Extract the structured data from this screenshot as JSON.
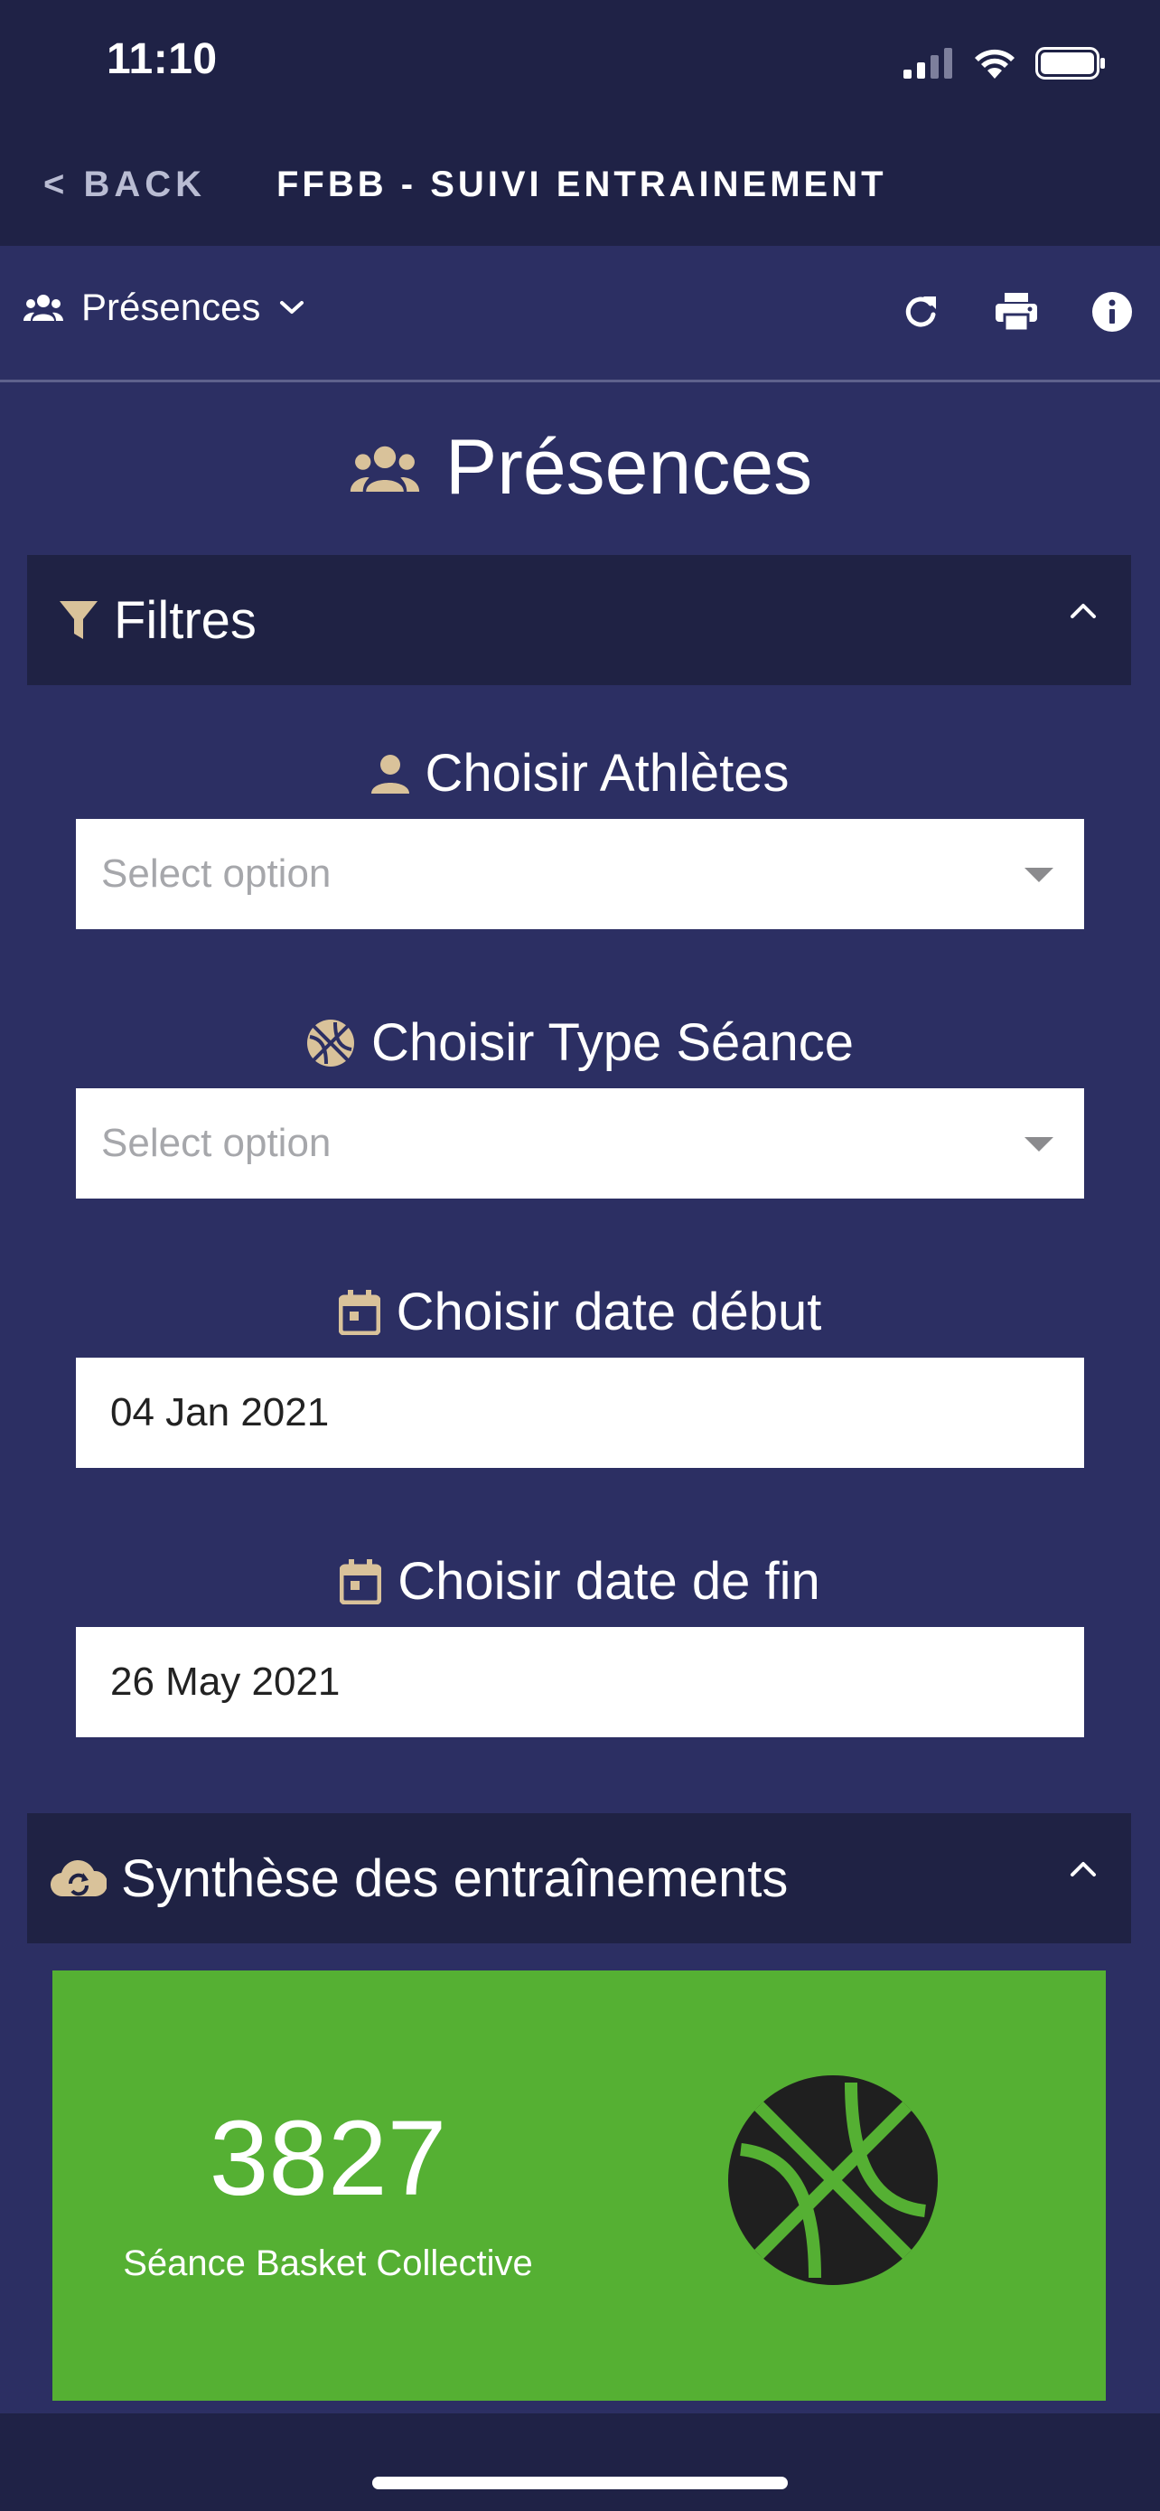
{
  "status_bar": {
    "time": "11:10"
  },
  "nav": {
    "back_label": "< BACK",
    "title": "FFBB - SUIVI ENTRAINEMENT"
  },
  "toolbar": {
    "page_selector_label": "Présences"
  },
  "page": {
    "title": "Présences"
  },
  "filters": {
    "header": "Filtres",
    "athletes": {
      "label": "Choisir Athlètes",
      "placeholder": "Select option"
    },
    "session_type": {
      "label": "Choisir Type Séance",
      "placeholder": "Select option"
    },
    "start_date": {
      "label": "Choisir date début",
      "value": "04 Jan 2021"
    },
    "end_date": {
      "label": "Choisir date de fin",
      "value": "26 May 2021"
    }
  },
  "summary": {
    "header": "Synthèse des entraînements",
    "card": {
      "value": "3827",
      "label": "Séance Basket Collective",
      "color": "#55b033"
    }
  },
  "colors": {
    "background": "#2c2f63",
    "bar": "#1f2246",
    "accent_icon": "#d9c29a",
    "card_green": "#55b033"
  },
  "icons": [
    "wifi-icon",
    "battery-icon",
    "signal-icon",
    "group-icon",
    "chevron-down-icon",
    "refresh-icon",
    "print-icon",
    "info-icon",
    "filter-icon",
    "chevron-up-icon",
    "person-icon",
    "basketball-icon",
    "calendar-icon",
    "cloud-sync-icon"
  ]
}
